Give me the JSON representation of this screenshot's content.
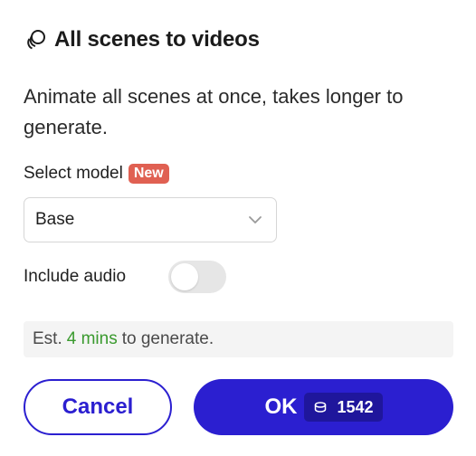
{
  "dialog": {
    "title": "All scenes to videos",
    "title_icon": "stack-circles-icon",
    "description": "Animate all scenes at once, takes longer to generate."
  },
  "model": {
    "label": "Select model",
    "badge": "New",
    "selected": "Base",
    "chevron_icon": "chevron-down-icon"
  },
  "audio": {
    "label": "Include audio",
    "enabled": false
  },
  "estimate": {
    "prefix": "Est.",
    "time": "4 mins",
    "suffix": "to generate."
  },
  "actions": {
    "cancel_label": "Cancel",
    "ok_label": "OK",
    "credits": "1542",
    "credit_icon": "coin-stack-icon"
  },
  "colors": {
    "accent": "#2b1fd0",
    "badge": "#e06052",
    "estimate_time": "#3a9a2e",
    "toggle_off": "#e6e6e6"
  }
}
